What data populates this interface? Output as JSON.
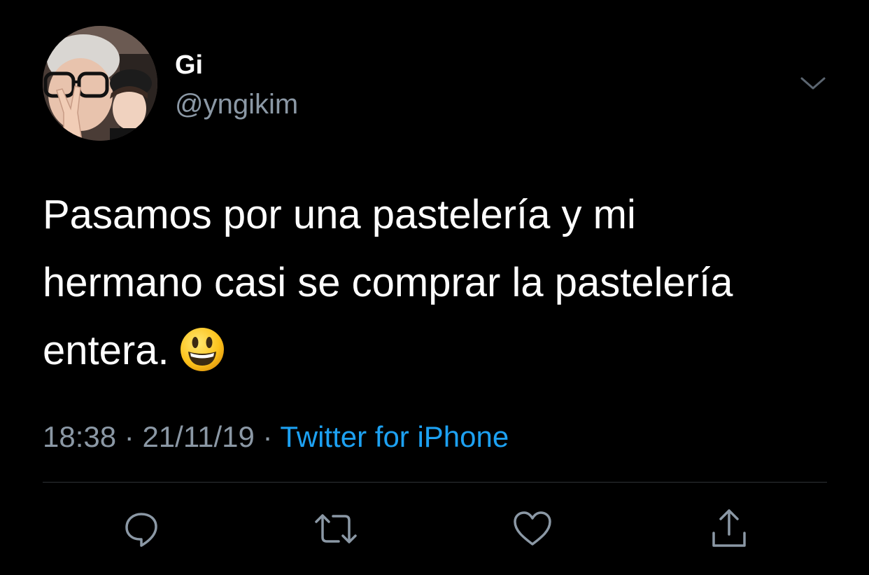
{
  "tweet": {
    "display_name": "Gi",
    "handle": "@yngikim",
    "text_lines": [
      "Pasamos por una pastelería y mi",
      "hermano casi se comprar la pastelería",
      "entera."
    ],
    "emoji": "smiley-face-emoji",
    "time": "18:38",
    "separator": "·",
    "date": "21/11/19",
    "source": "Twitter for iPhone"
  },
  "actions": {
    "icons": [
      "reply-icon",
      "retweet-icon",
      "like-icon",
      "share-icon"
    ]
  },
  "colors": {
    "background": "#000000",
    "primary_text": "#ffffff",
    "secondary_text": "#8b98a5",
    "link": "#1da1f2",
    "divider": "#2f3336"
  }
}
